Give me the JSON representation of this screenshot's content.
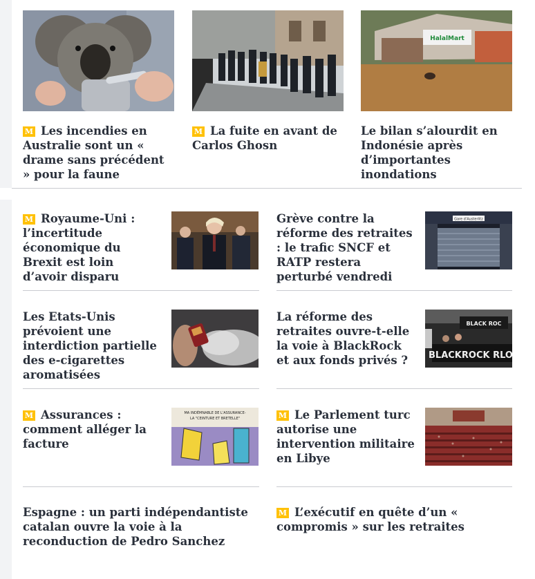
{
  "top_articles": [
    {
      "title": "Les incendies en Australie sont un « drame sans précédent » pour la faune",
      "premium": true,
      "image": "koala-photo"
    },
    {
      "title": "La fuite en avant de Carlos Ghosn",
      "premium": true,
      "image": "crowd-street-photo"
    },
    {
      "title": "Le bilan s’alourdit en Indonésie après d’importantes inondations",
      "premium": false,
      "image": "flood-photo"
    }
  ],
  "grid_articles": [
    {
      "title": "Royaume-Uni : l’incertitude économique du Brexit est loin d’avoir disparu",
      "premium": true,
      "image": "boris-johnson-photo"
    },
    {
      "title": "Grève contre la réforme des retraites : le trafic SNCF et RATP restera perturbé vendredi",
      "premium": false,
      "image": "closed-metro-station-photo"
    },
    {
      "title": "Les Etats-Unis prévoient une interdiction partielle des e-cigarettes aromatisées",
      "premium": false,
      "image": "vape-photo"
    },
    {
      "title": "La réforme des retraites ouvre-t-elle la voie à BlackRock et aux fonds privés ?",
      "premium": false,
      "image": "blackrock-protest-photo"
    },
    {
      "title": "Assurances : comment alléger la facture",
      "premium": true,
      "image": "cartoon-illustration"
    },
    {
      "title": "Le Parlement turc autorise une intervention militaire en Libye",
      "premium": true,
      "image": "parliament-photo"
    },
    {
      "title": "Espagne : un parti indépendantiste catalan ouvre la voie à la reconduction de Pedro Sanchez",
      "premium": false
    },
    {
      "title": "L’exécutif en quête d’un « compromis » sur les retraites",
      "premium": true
    }
  ],
  "image_texts": {
    "cartoon_line1": "MA INDÉMNABLE DE L'ASSURANCE-",
    "cartoon_line2": "LA \"CEINTURE ET BRETELLE\"",
    "metro_sign": "Gare d'Austerlitz",
    "store_sign": "HalalMart",
    "banner": "BLACKROCK RLO",
    "banner2": "BLACK ROC"
  },
  "badge_glyph": "M",
  "colors": {
    "badge": "#ffc107",
    "text": "#2a303b",
    "divider": "#c9cbd0"
  }
}
